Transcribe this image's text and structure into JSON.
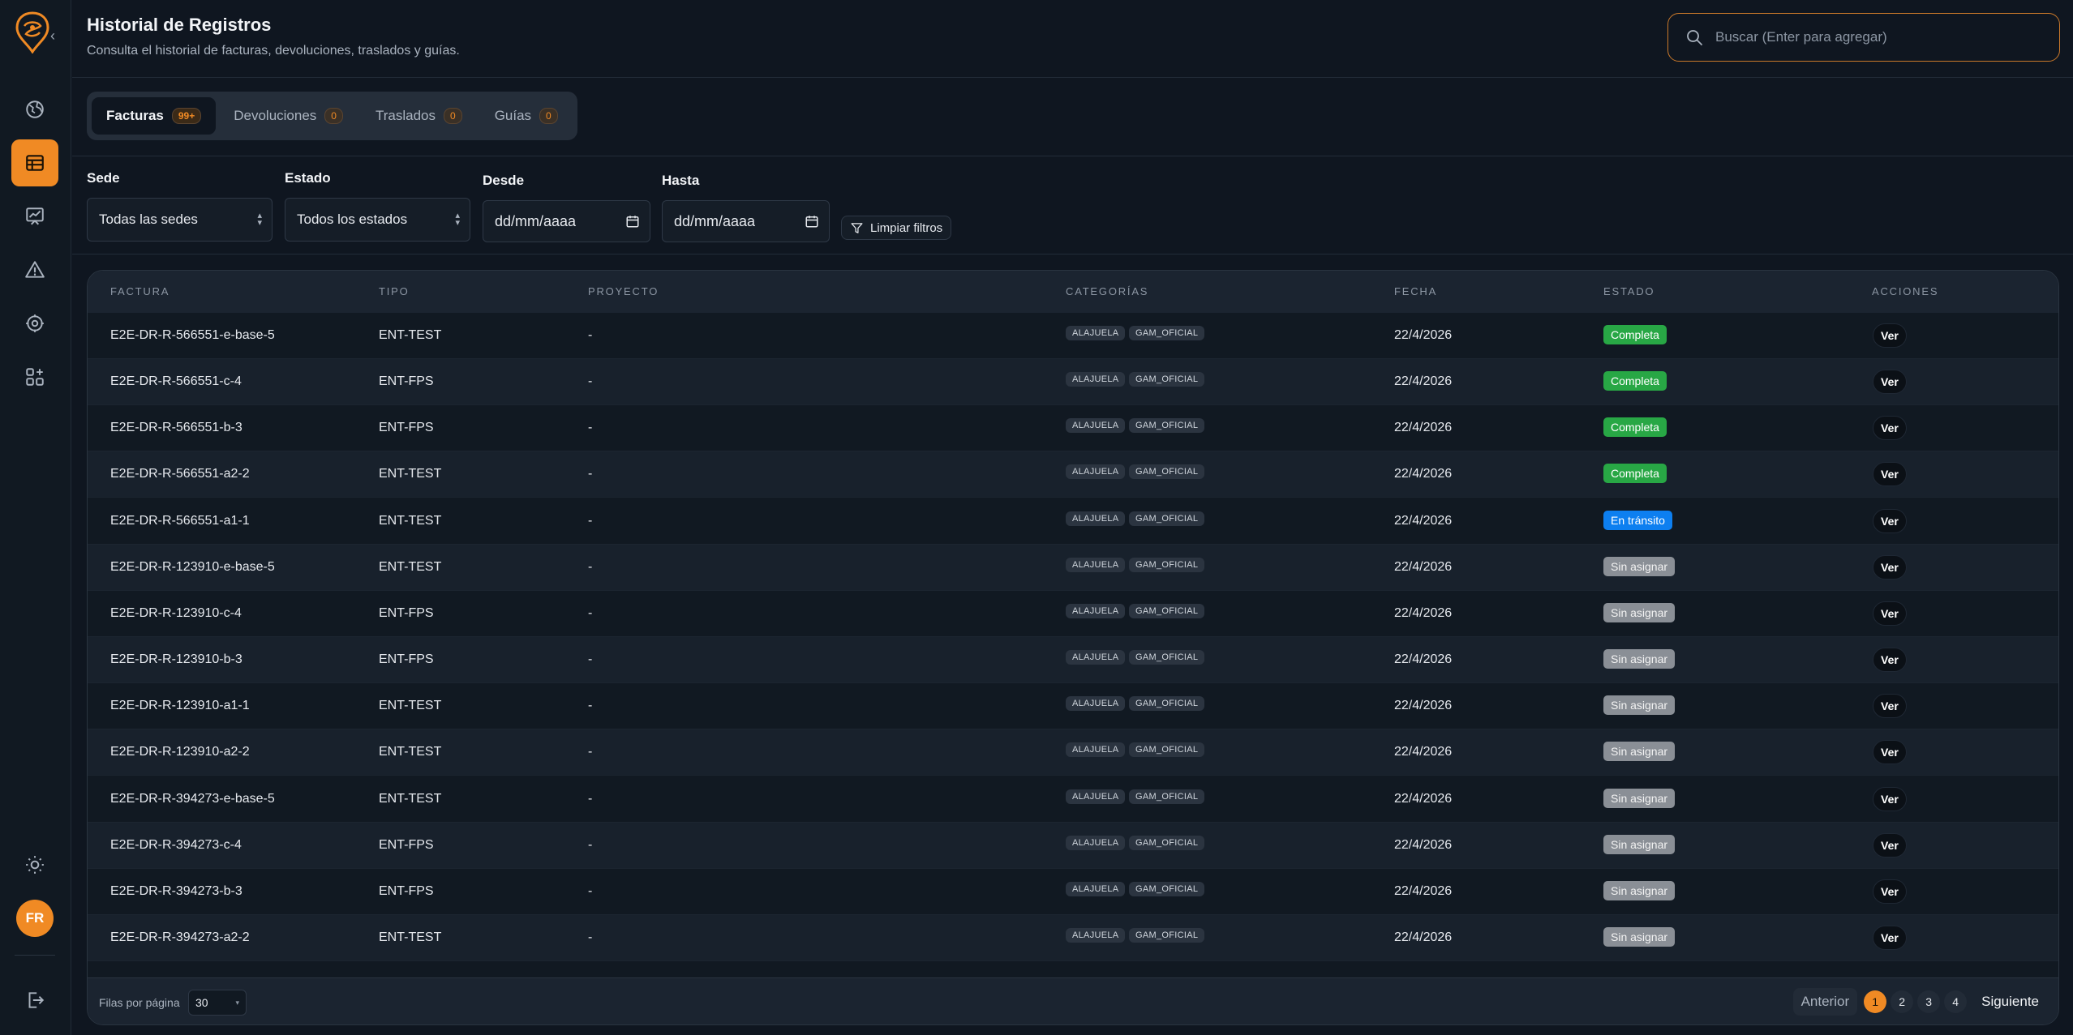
{
  "header": {
    "title": "Historial de Registros",
    "subtitle": "Consulta el historial de facturas, devoluciones, traslados y guías.",
    "search_placeholder": "Buscar (Enter para agregar)"
  },
  "user": {
    "initials": "FR"
  },
  "tabs": [
    {
      "label": "Facturas",
      "count": "99+"
    },
    {
      "label": "Devoluciones",
      "count": "0"
    },
    {
      "label": "Traslados",
      "count": "0"
    },
    {
      "label": "Guías",
      "count": "0"
    }
  ],
  "filters": {
    "sede": {
      "label": "Sede",
      "value": "Todas las sedes"
    },
    "estado": {
      "label": "Estado",
      "value": "Todos los estados"
    },
    "desde": {
      "label": "Desde",
      "value": "dd/mm/aaaa"
    },
    "hasta": {
      "label": "Hasta",
      "value": "dd/mm/aaaa"
    },
    "clear_label": "Limpiar filtros"
  },
  "table": {
    "columns": [
      "FACTURA",
      "TIPO",
      "PROYECTO",
      "CATEGORÍAS",
      "FECHA",
      "ESTADO",
      "ACCIONES"
    ],
    "action_label": "Ver",
    "status_colors": {
      "Completa": "#28a745",
      "En tránsito": "#0d7ff0",
      "Sin asignar": "#8a8f96"
    },
    "rows": [
      {
        "factura": "E2E-DR-R-566551-e-base-5",
        "tipo": "ENT-TEST",
        "proyecto": "-",
        "categorias": [
          "ALAJUELA",
          "GAM_OFICIAL"
        ],
        "fecha": "22/4/2026",
        "estado": "Completa"
      },
      {
        "factura": "E2E-DR-R-566551-c-4",
        "tipo": "ENT-FPS",
        "proyecto": "-",
        "categorias": [
          "ALAJUELA",
          "GAM_OFICIAL"
        ],
        "fecha": "22/4/2026",
        "estado": "Completa"
      },
      {
        "factura": "E2E-DR-R-566551-b-3",
        "tipo": "ENT-FPS",
        "proyecto": "-",
        "categorias": [
          "ALAJUELA",
          "GAM_OFICIAL"
        ],
        "fecha": "22/4/2026",
        "estado": "Completa"
      },
      {
        "factura": "E2E-DR-R-566551-a2-2",
        "tipo": "ENT-TEST",
        "proyecto": "-",
        "categorias": [
          "ALAJUELA",
          "GAM_OFICIAL"
        ],
        "fecha": "22/4/2026",
        "estado": "Completa"
      },
      {
        "factura": "E2E-DR-R-566551-a1-1",
        "tipo": "ENT-TEST",
        "proyecto": "-",
        "categorias": [
          "ALAJUELA",
          "GAM_OFICIAL"
        ],
        "fecha": "22/4/2026",
        "estado": "En tránsito"
      },
      {
        "factura": "E2E-DR-R-123910-e-base-5",
        "tipo": "ENT-TEST",
        "proyecto": "-",
        "categorias": [
          "ALAJUELA",
          "GAM_OFICIAL"
        ],
        "fecha": "22/4/2026",
        "estado": "Sin asignar"
      },
      {
        "factura": "E2E-DR-R-123910-c-4",
        "tipo": "ENT-FPS",
        "proyecto": "-",
        "categorias": [
          "ALAJUELA",
          "GAM_OFICIAL"
        ],
        "fecha": "22/4/2026",
        "estado": "Sin asignar"
      },
      {
        "factura": "E2E-DR-R-123910-b-3",
        "tipo": "ENT-FPS",
        "proyecto": "-",
        "categorias": [
          "ALAJUELA",
          "GAM_OFICIAL"
        ],
        "fecha": "22/4/2026",
        "estado": "Sin asignar"
      },
      {
        "factura": "E2E-DR-R-123910-a1-1",
        "tipo": "ENT-TEST",
        "proyecto": "-",
        "categorias": [
          "ALAJUELA",
          "GAM_OFICIAL"
        ],
        "fecha": "22/4/2026",
        "estado": "Sin asignar"
      },
      {
        "factura": "E2E-DR-R-123910-a2-2",
        "tipo": "ENT-TEST",
        "proyecto": "-",
        "categorias": [
          "ALAJUELA",
          "GAM_OFICIAL"
        ],
        "fecha": "22/4/2026",
        "estado": "Sin asignar"
      },
      {
        "factura": "E2E-DR-R-394273-e-base-5",
        "tipo": "ENT-TEST",
        "proyecto": "-",
        "categorias": [
          "ALAJUELA",
          "GAM_OFICIAL"
        ],
        "fecha": "22/4/2026",
        "estado": "Sin asignar"
      },
      {
        "factura": "E2E-DR-R-394273-c-4",
        "tipo": "ENT-FPS",
        "proyecto": "-",
        "categorias": [
          "ALAJUELA",
          "GAM_OFICIAL"
        ],
        "fecha": "22/4/2026",
        "estado": "Sin asignar"
      },
      {
        "factura": "E2E-DR-R-394273-b-3",
        "tipo": "ENT-FPS",
        "proyecto": "-",
        "categorias": [
          "ALAJUELA",
          "GAM_OFICIAL"
        ],
        "fecha": "22/4/2026",
        "estado": "Sin asignar"
      },
      {
        "factura": "E2E-DR-R-394273-a2-2",
        "tipo": "ENT-TEST",
        "proyecto": "-",
        "categorias": [
          "ALAJUELA",
          "GAM_OFICIAL"
        ],
        "fecha": "22/4/2026",
        "estado": "Sin asignar"
      }
    ]
  },
  "pagination": {
    "rows_label": "Filas por página",
    "rows_value": "30",
    "prev_label": "Anterior",
    "next_label": "Siguiente",
    "pages": [
      "1",
      "2",
      "3",
      "4"
    ],
    "current_page": "1"
  },
  "colors": {
    "accent": "#f08a24",
    "background": "#0f1620"
  },
  "icons": {
    "sidebar": [
      "globe-icon",
      "table-icon",
      "chart-icon",
      "alert-icon",
      "settings-icon",
      "apps-add-icon"
    ],
    "theme": "sun-icon",
    "logout": "logout-icon",
    "search": "search-icon",
    "filter": "filter-icon",
    "calendar": "calendar-icon"
  }
}
